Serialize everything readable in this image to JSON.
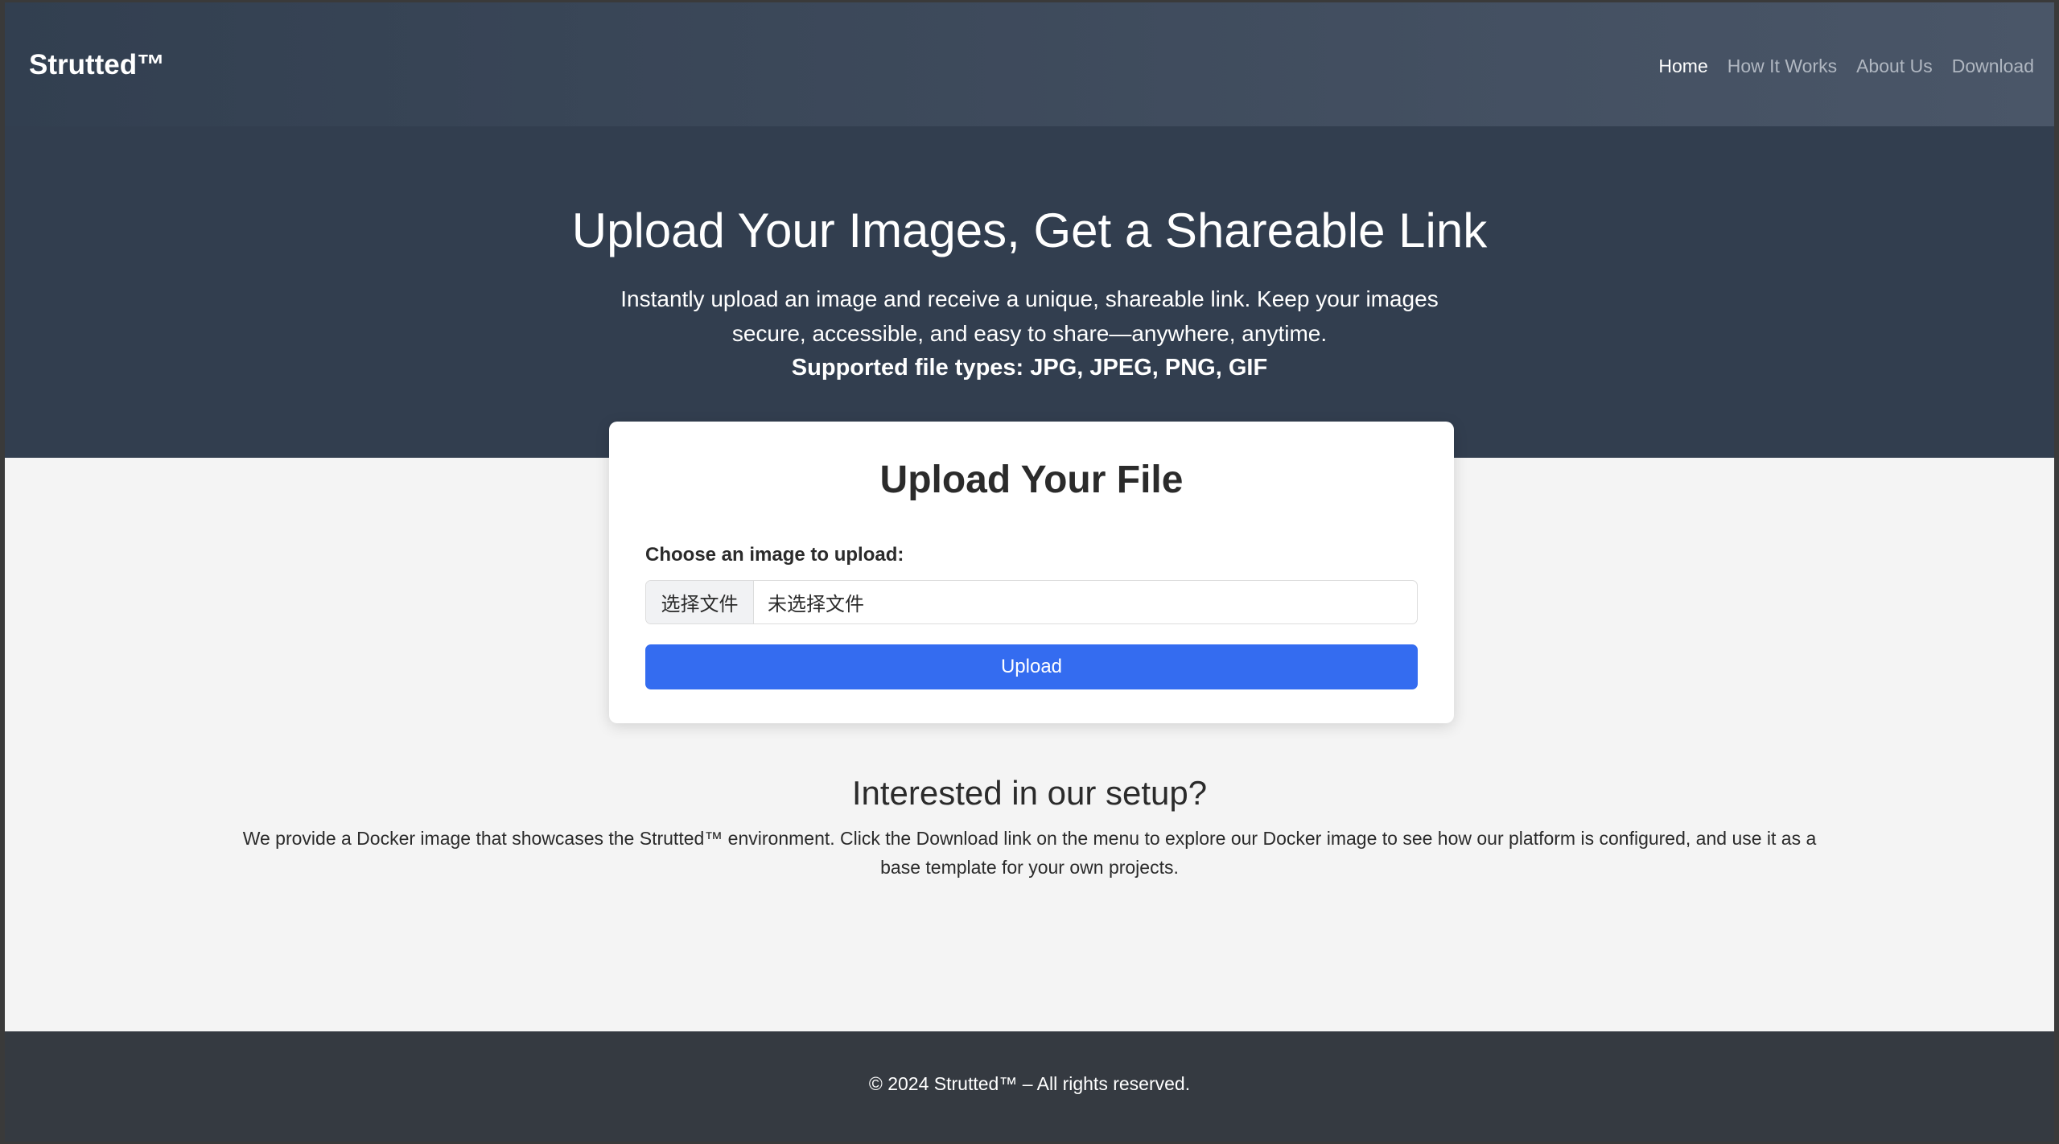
{
  "brand": "Strutted™",
  "nav": {
    "items": [
      {
        "label": "Home",
        "active": true
      },
      {
        "label": "How It Works",
        "active": false
      },
      {
        "label": "About Us",
        "active": false
      },
      {
        "label": "Download",
        "active": false
      }
    ]
  },
  "hero": {
    "title": "Upload Your Images, Get a Shareable Link",
    "description": "Instantly upload an image and receive a unique, shareable link. Keep your images secure, accessible, and easy to share—anywhere, anytime.",
    "file_types": "Supported file types: JPG, JPEG, PNG, GIF"
  },
  "upload_card": {
    "title": "Upload Your File",
    "label": "Choose an image to upload:",
    "file_button": "选择文件",
    "file_status": "未选择文件",
    "submit_label": "Upload"
  },
  "setup": {
    "title": "Interested in our setup?",
    "description": "We provide a Docker image that showcases the Strutted™ environment. Click the Download link on the menu to explore our Docker image to see how our platform is configured, and use it as a base template for your own projects."
  },
  "footer": {
    "text": "© 2024 Strutted™ – All rights reserved."
  },
  "colors": {
    "nav_bg": "#323f50",
    "hero_bg": "#323e4f",
    "accent": "#346cf0",
    "page_bg": "#f4f4f4",
    "footer_bg": "#353a41"
  }
}
